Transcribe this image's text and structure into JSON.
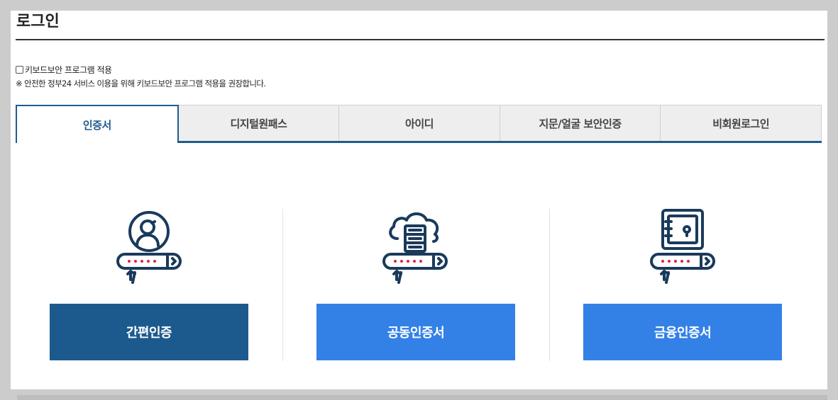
{
  "page": {
    "title": "로그인"
  },
  "keyboard_security": {
    "label": "키보드보안 프로그램 적용",
    "checked": false,
    "notice": "※ 안전한 정부24 서비스 이용을 위해 키보드보안 프로그램 적용을 권장합니다."
  },
  "tabs": [
    {
      "label": "인증서",
      "active": true
    },
    {
      "label": "디지털원패스",
      "active": false
    },
    {
      "label": "아이디",
      "active": false
    },
    {
      "label": "지문/얼굴 보안인증",
      "active": false
    },
    {
      "label": "비회원로그인",
      "active": false
    }
  ],
  "methods": [
    {
      "label": "간편인증",
      "icon": "user-password-icon",
      "color": "#1c5a8e"
    },
    {
      "label": "공동인증서",
      "icon": "cloud-server-password-icon",
      "color": "#3381e6"
    },
    {
      "label": "금융인증서",
      "icon": "safe-password-icon",
      "color": "#3381e6"
    }
  ],
  "colors": {
    "primary": "#1c5a8e",
    "accent": "#3381e6",
    "icon_stroke": "#1a3a5c",
    "dot": "#e1204a"
  }
}
